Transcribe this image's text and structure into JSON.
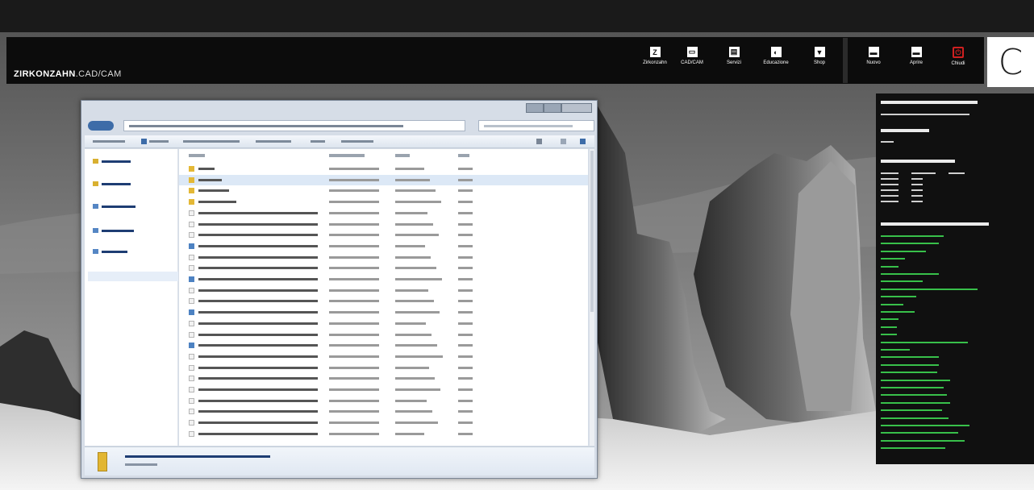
{
  "app": {
    "title_bold": "ZIRKONZAHN",
    "title_rest": ".CAD/CAM"
  },
  "toolbar_left": [
    {
      "icon": "z-icon",
      "glyph": "Z",
      "label": "Zirkonzahn"
    },
    {
      "icon": "cad-cam-icon",
      "glyph": "▭",
      "label": "CAD/CAM"
    },
    {
      "icon": "service-icon",
      "glyph": "▤",
      "label": "Servizi"
    },
    {
      "icon": "education-icon",
      "glyph": "◐",
      "label": "Educazione"
    },
    {
      "icon": "shop-cart-icon",
      "glyph": "▼",
      "label": "Shop"
    }
  ],
  "toolbar_right": [
    {
      "icon": "new-icon",
      "glyph": "▬",
      "label": "Nuovo"
    },
    {
      "icon": "open-icon",
      "glyph": "▬",
      "label": "Aprire"
    },
    {
      "icon": "power-icon",
      "glyph": "⏻",
      "label": "Chiudi"
    }
  ],
  "logo": {
    "letter": "C"
  },
  "colors": {
    "info_link": "#38c04a",
    "power_red": "#d02020"
  }
}
